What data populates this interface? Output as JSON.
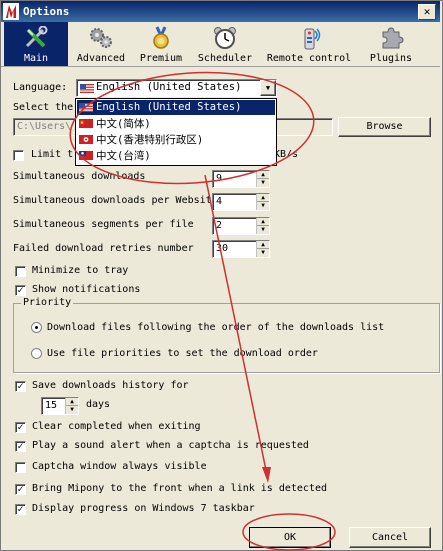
{
  "window": {
    "title": "Options",
    "close_glyph": "✕"
  },
  "toolbar": {
    "items": [
      {
        "id": "main",
        "label": "Main",
        "icon": "tools-icon"
      },
      {
        "id": "advanced",
        "label": "Advanced",
        "icon": "gears-icon"
      },
      {
        "id": "premium",
        "label": "Premium",
        "icon": "medal-icon"
      },
      {
        "id": "scheduler",
        "label": "Scheduler",
        "icon": "alarm-clock-icon"
      },
      {
        "id": "remote",
        "label": "Remote control",
        "icon": "remote-control-icon"
      },
      {
        "id": "plugins",
        "label": "Plugins",
        "icon": "puzzle-icon"
      }
    ]
  },
  "language": {
    "label": "Language:",
    "selected": "English (United States)",
    "options": [
      {
        "text": "English (United States)",
        "flag": "us-flag-icon"
      },
      {
        "text": "中文(简体)",
        "flag": "cn-flag-icon"
      },
      {
        "text": "中文(香港特别行政区)",
        "flag": "hk-flag-icon"
      },
      {
        "text": "中文(台湾)",
        "flag": "tw-flag-icon"
      }
    ]
  },
  "folder": {
    "label_partial": "Select the",
    "path_partial": "C:\\Users\\",
    "browse_label": "Browse"
  },
  "limit": {
    "label_partial": "Limit t",
    "unit_partial": "KB/s",
    "checked": false
  },
  "settings": {
    "simultaneous_downloads": {
      "label": "Simultaneous downloads",
      "value": "9"
    },
    "per_website": {
      "label": "Simultaneous downloads per Websit",
      "value": "4"
    },
    "segments": {
      "label": "Simultaneous segments per file",
      "value": "2"
    },
    "retries": {
      "label": "Failed download retries number",
      "value": "30"
    }
  },
  "checks": {
    "minimize_tray": {
      "label": "Minimize to tray",
      "checked": false
    },
    "notifications": {
      "label": "Show notifications",
      "checked": true
    }
  },
  "priority": {
    "legend": "Priority",
    "option_order": "Download files following the order of the downloads list",
    "option_priorities": "Use file priorities to set the download order",
    "selected": "option_order"
  },
  "history": {
    "label": "Save downloads history for",
    "value": "15",
    "unit": "days",
    "checked": true
  },
  "more_checks": {
    "clear_completed": {
      "label": "Clear completed when exiting",
      "checked": true
    },
    "sound_alert": {
      "label": "Play a sound alert when a captcha is requested",
      "checked": true
    },
    "captcha_visible": {
      "label": "Captcha window always visible",
      "checked": false
    },
    "bring_front": {
      "label": "Bring Mipony to the front when a link is detected",
      "checked": true
    },
    "taskbar_progress": {
      "label": "Display progress on Windows 7 taskbar",
      "checked": true
    }
  },
  "buttons": {
    "ok": "OK",
    "cancel": "Cancel"
  },
  "check_glyph": "✓",
  "dropdown_arrow": "▼",
  "spin_up": "▲",
  "spin_down": "▼",
  "colors": {
    "titlebar": "#0a246a",
    "selection": "#0a246a",
    "annotation": "#d03030",
    "face": "#ece9d8"
  }
}
